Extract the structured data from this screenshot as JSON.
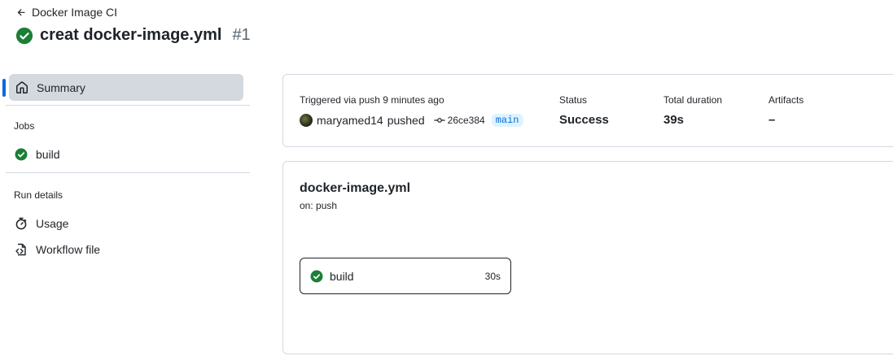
{
  "header": {
    "back_label": "Docker Image CI",
    "title": "creat docker-image.yml",
    "run_number": "#1"
  },
  "sidebar": {
    "summary_label": "Summary",
    "jobs_heading": "Jobs",
    "jobs": [
      {
        "label": "build",
        "status": "success"
      }
    ],
    "run_details_heading": "Run details",
    "usage_label": "Usage",
    "workflow_file_label": "Workflow file"
  },
  "summary": {
    "trigger_text": "Triggered via push 9 minutes ago",
    "actor": "maryamed14",
    "action": "pushed",
    "commit_sha": "26ce384",
    "branch": "main",
    "status_label": "Status",
    "status_value": "Success",
    "duration_label": "Total duration",
    "duration_value": "39s",
    "artifacts_label": "Artifacts",
    "artifacts_value": "–"
  },
  "workflow": {
    "file_name": "docker-image.yml",
    "trigger": "on: push",
    "job_name": "build",
    "job_duration": "30s"
  },
  "colors": {
    "success": "#1a7f37",
    "accent": "#0969da"
  }
}
